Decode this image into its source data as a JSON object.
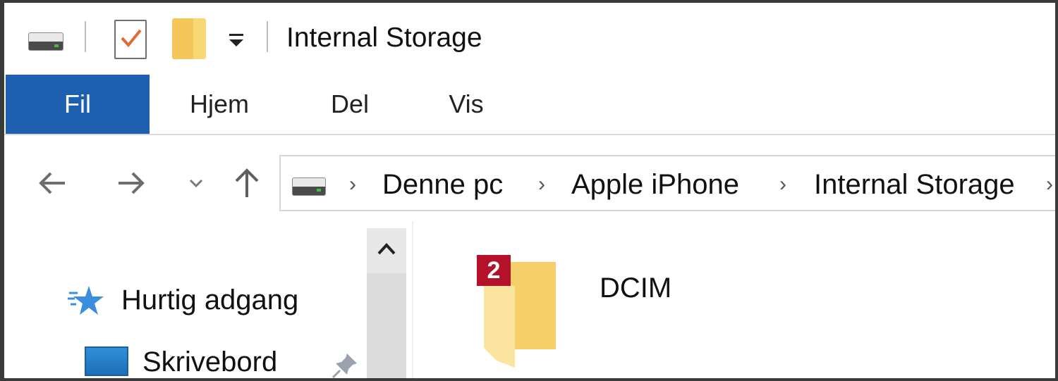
{
  "window": {
    "title": "Internal Storage"
  },
  "quick_access_toolbar": {
    "icons": [
      "drive-icon",
      "properties-icon",
      "new-folder-icon",
      "customize-dropdown-icon"
    ]
  },
  "ribbon": {
    "tabs": [
      {
        "label": "Fil",
        "active": true
      },
      {
        "label": "Hjem",
        "active": false
      },
      {
        "label": "Del",
        "active": false
      },
      {
        "label": "Vis",
        "active": false
      }
    ],
    "active_color": "#1f5fb0"
  },
  "navigation": {
    "buttons": [
      "back-arrow-icon",
      "forward-arrow-icon",
      "recent-locations-icon",
      "up-arrow-icon"
    ]
  },
  "addressbar": {
    "path": [
      "Denne pc",
      "Apple iPhone",
      "Internal Storage"
    ]
  },
  "nav_pane": {
    "items": [
      {
        "label": "Hurtig adgang",
        "icon": "star-icon"
      },
      {
        "label": "Skrivebord",
        "icon": "desktop-icon",
        "pinned": true
      }
    ]
  },
  "content": {
    "items": [
      {
        "name": "DCIM",
        "type": "folder",
        "badge": "2"
      }
    ]
  }
}
